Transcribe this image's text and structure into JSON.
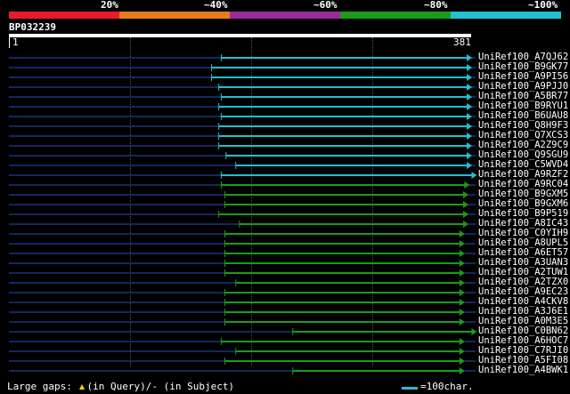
{
  "legend": {
    "labels": [
      "20%",
      "~40%",
      "~60%",
      "~80%",
      "~100%"
    ],
    "colors": [
      "#e8192c",
      "#e87b1e",
      "#9b2c9b",
      "#1b9b1b",
      "#21c0d0"
    ]
  },
  "query": {
    "name": "BP032239",
    "start": "1",
    "end": "381",
    "length": 381
  },
  "axis": {
    "ticks": [
      100,
      200,
      300
    ]
  },
  "hits": [
    {
      "name": "UniRef100_A7QJ62",
      "start": 176,
      "end": 381,
      "color": "cyan"
    },
    {
      "name": "UniRef100_B9GK77",
      "start": 168,
      "end": 381,
      "color": "cyan"
    },
    {
      "name": "UniRef100_A9PI56",
      "start": 168,
      "end": 381,
      "color": "cyan"
    },
    {
      "name": "UniRef100_A9PJJ0",
      "start": 174,
      "end": 381,
      "color": "cyan"
    },
    {
      "name": "UniRef100_A5BR77",
      "start": 176,
      "end": 381,
      "color": "cyan"
    },
    {
      "name": "UniRef100_B9RYU1",
      "start": 174,
      "end": 381,
      "color": "cyan"
    },
    {
      "name": "UniRef100_B6UAU8",
      "start": 176,
      "end": 381,
      "color": "cyan"
    },
    {
      "name": "UniRef100_Q8H9F3",
      "start": 174,
      "end": 381,
      "color": "cyan"
    },
    {
      "name": "UniRef100_Q7XCS3",
      "start": 174,
      "end": 381,
      "color": "cyan"
    },
    {
      "name": "UniRef100_A2Z9C9",
      "start": 174,
      "end": 381,
      "color": "cyan"
    },
    {
      "name": "UniRef100_Q9SGU9",
      "start": 180,
      "end": 381,
      "color": "cyan"
    },
    {
      "name": "UniRef100_C5WVD4",
      "start": 188,
      "end": 381,
      "color": "cyan"
    },
    {
      "name": "UniRef100_A9RZF2",
      "start": 176,
      "end": 385,
      "color": "cyan"
    },
    {
      "name": "UniRef100_A9RC04",
      "start": 176,
      "end": 379,
      "color": "green"
    },
    {
      "name": "UniRef100_B9GXM5",
      "start": 179,
      "end": 378,
      "color": "green"
    },
    {
      "name": "UniRef100_B9GXM6",
      "start": 179,
      "end": 378,
      "color": "green"
    },
    {
      "name": "UniRef100_B9P519",
      "start": 174,
      "end": 378,
      "color": "green"
    },
    {
      "name": "UniRef100_A8IC43",
      "start": 191,
      "end": 378,
      "color": "green"
    },
    {
      "name": "UniRef100_C0YIH9",
      "start": 179,
      "end": 375,
      "color": "green"
    },
    {
      "name": "UniRef100_A8UPL5",
      "start": 179,
      "end": 375,
      "color": "green"
    },
    {
      "name": "UniRef100_A6ET57",
      "start": 179,
      "end": 375,
      "color": "green"
    },
    {
      "name": "UniRef100_A3UAN3",
      "start": 179,
      "end": 375,
      "color": "green"
    },
    {
      "name": "UniRef100_A2TUW1",
      "start": 179,
      "end": 375,
      "color": "green"
    },
    {
      "name": "UniRef100_A2TZX0",
      "start": 188,
      "end": 375,
      "color": "green"
    },
    {
      "name": "UniRef100_A9EC23",
      "start": 179,
      "end": 375,
      "color": "green"
    },
    {
      "name": "UniRef100_A4CKV8",
      "start": 179,
      "end": 375,
      "color": "green"
    },
    {
      "name": "UniRef100_A3J6E1",
      "start": 179,
      "end": 375,
      "color": "green"
    },
    {
      "name": "UniRef100_A0M3E5",
      "start": 179,
      "end": 375,
      "color": "green"
    },
    {
      "name": "UniRef100_C0BN62",
      "start": 235,
      "end": 385,
      "color": "green"
    },
    {
      "name": "UniRef100_A6HOC7",
      "start": 176,
      "end": 375,
      "color": "green"
    },
    {
      "name": "UniRef100_C7RJI0",
      "start": 188,
      "end": 375,
      "color": "green"
    },
    {
      "name": "UniRef100_A5FI08",
      "start": 179,
      "end": 375,
      "color": "green"
    },
    {
      "name": "UniRef100_A4BWK1",
      "start": 235,
      "end": 375,
      "color": "green"
    }
  ],
  "footer": {
    "gaps_label": "Large gaps:",
    "in_query": "(in Query)/",
    "in_subject": "- (in Subject)",
    "scale_label": "=100char."
  }
}
